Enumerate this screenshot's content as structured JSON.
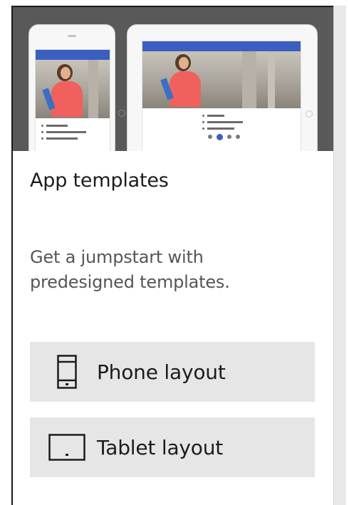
{
  "panel": {
    "title": "App templates",
    "description": "Get a jumpstart with predesigned templates."
  },
  "buttons": [
    {
      "label": "Phone layout",
      "icon": "phone-icon"
    },
    {
      "label": "Tablet layout",
      "icon": "tablet-icon"
    }
  ],
  "colors": {
    "preview_background": "#595959",
    "button_background": "#e6e6e6",
    "mock_header": "#3b5fc0",
    "scrollbar": "#e9e9e9"
  }
}
